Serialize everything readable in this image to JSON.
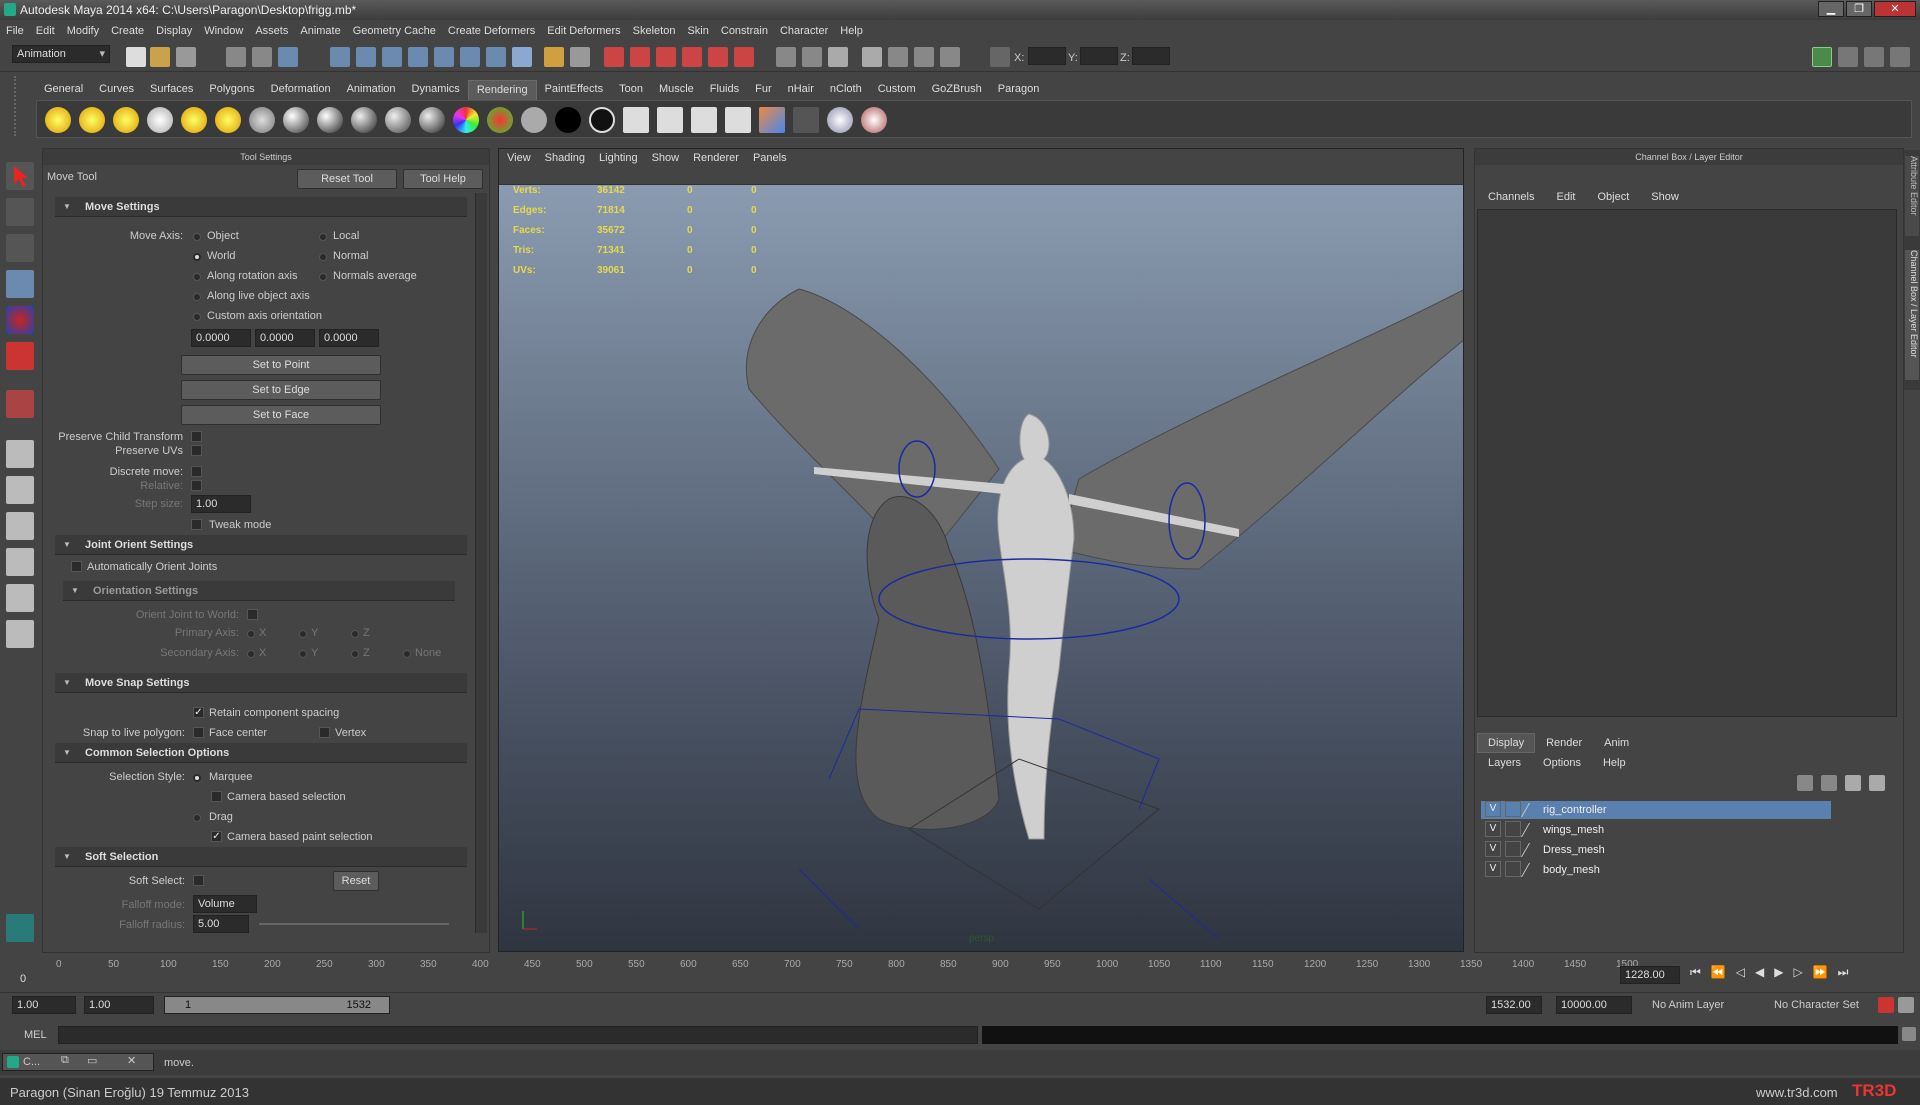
{
  "window": {
    "title": "Autodesk Maya 2014 x64: C:\\Users\\Paragon\\Desktop\\frigg.mb*",
    "min": "▁",
    "max": "❐",
    "close": "✕"
  },
  "menus": [
    "File",
    "Edit",
    "Modify",
    "Create",
    "Display",
    "Window",
    "Assets",
    "Animate",
    "Geometry Cache",
    "Create Deformers",
    "Edit Deformers",
    "Skeleton",
    "Skin",
    "Constrain",
    "Character",
    "Help"
  ],
  "statusline": {
    "mode": "Animation",
    "x_label": "X:",
    "y_label": "Y:",
    "z_label": "Z:"
  },
  "shelf_tabs": [
    "General",
    "Curves",
    "Surfaces",
    "Polygons",
    "Deformation",
    "Animation",
    "Dynamics",
    "Rendering",
    "PaintEffects",
    "Toon",
    "Muscle",
    "Fluids",
    "Fur",
    "nHair",
    "nCloth",
    "Custom",
    "GoZBrush",
    "Paragon"
  ],
  "shelf_active": "Rendering",
  "tool_settings": {
    "header": "Tool Settings",
    "tool_name": "Move Tool",
    "reset_tool": "Reset Tool",
    "tool_help": "Tool Help",
    "move_settings": "Move Settings",
    "move_axis": "Move Axis:",
    "axis_options": {
      "object": "Object",
      "local": "Local",
      "world": "World",
      "normal": "Normal",
      "along_rot": "Along rotation axis",
      "normals_avg": "Normals average",
      "along_live": "Along live object axis",
      "custom": "Custom axis orientation"
    },
    "axis_values": [
      "0.0000",
      "0.0000",
      "0.0000"
    ],
    "set_to_point": "Set to Point",
    "set_to_edge": "Set to Edge",
    "set_to_face": "Set to Face",
    "preserve_child": "Preserve Child Transform",
    "preserve_uvs": "Preserve UVs",
    "discrete_move": "Discrete move:",
    "relative": "Relative:",
    "step_size": "Step size:",
    "step_value": "1.00",
    "tweak_mode": "Tweak mode",
    "joint_orient": "Joint Orient Settings",
    "auto_orient": "Automatically Orient Joints",
    "orientation_settings": "Orientation Settings",
    "orient_world": "Orient Joint to World:",
    "primary_axis": "Primary Axis:",
    "secondary_axis": "Secondary Axis:",
    "x": "X",
    "y": "Y",
    "z": "Z",
    "none": "None",
    "move_snap": "Move Snap Settings",
    "retain_spacing": "Retain component spacing",
    "snap_live": "Snap to live polygon:",
    "face_center": "Face center",
    "vertex": "Vertex",
    "common_sel": "Common Selection Options",
    "sel_style": "Selection Style:",
    "marquee": "Marquee",
    "camera_sel": "Camera based selection",
    "drag": "Drag",
    "camera_paint": "Camera based paint selection",
    "soft_sel": "Soft Selection",
    "soft_select": "Soft Select:",
    "reset": "Reset",
    "falloff_mode": "Falloff mode:",
    "falloff_mode_val": "Volume",
    "falloff_radius": "Falloff radius:",
    "falloff_radius_val": "5.00"
  },
  "viewport": {
    "menus": [
      "View",
      "Shading",
      "Lighting",
      "Show",
      "Renderer",
      "Panels"
    ],
    "hud": [
      {
        "label": "Verts:",
        "v": "36142",
        "a": "0",
        "b": "0"
      },
      {
        "label": "Edges:",
        "v": "71814",
        "a": "0",
        "b": "0"
      },
      {
        "label": "Faces:",
        "v": "35672",
        "a": "0",
        "b": "0"
      },
      {
        "label": "Tris:",
        "v": "71341",
        "a": "0",
        "b": "0"
      },
      {
        "label": "UVs:",
        "v": "39061",
        "a": "0",
        "b": "0"
      }
    ],
    "camera": "persp"
  },
  "channel_box": {
    "header": "Channel Box / Layer Editor",
    "menus": [
      "Channels",
      "Edit",
      "Object",
      "Show"
    ],
    "layer_tabs": [
      "Display",
      "Render",
      "Anim"
    ],
    "layer_menus": [
      "Layers",
      "Options",
      "Help"
    ],
    "layers": [
      {
        "v": "V",
        "name": "rig_controller",
        "selected": true
      },
      {
        "v": "V",
        "name": "wings_mesh"
      },
      {
        "v": "V",
        "name": "Dress_mesh"
      },
      {
        "v": "V",
        "name": "body_mesh"
      }
    ],
    "side_tabs": [
      "Attribute Editor",
      "Channel Box / Layer Editor"
    ]
  },
  "timeline": {
    "ticks": [
      "0",
      "50",
      "100",
      "150",
      "200",
      "250",
      "300",
      "350",
      "400",
      "450",
      "500",
      "550",
      "600",
      "650",
      "700",
      "750",
      "800",
      "850",
      "900",
      "950",
      "1000",
      "1050",
      "1100",
      "1150",
      "1200",
      "1250",
      "1300",
      "1350",
      "1400",
      "1450",
      "1500"
    ],
    "current": "0",
    "current_frame": "1228.00"
  },
  "range": {
    "start": "1.00",
    "pstart": "1.00",
    "slider_start": "1",
    "slider_end": "1532",
    "pend": "1532.00",
    "end": "10000.00",
    "anim_layer": "No Anim Layer",
    "char_set": "No Character Set"
  },
  "mel": {
    "label": "MEL"
  },
  "helpline": {
    "task": "C...",
    "msg": "move."
  },
  "footer": {
    "credit": "Paragon (Sinan Eroğlu)  19 Temmuz 2013",
    "site": "www.tr3d.com",
    "brand": "TR3D"
  }
}
